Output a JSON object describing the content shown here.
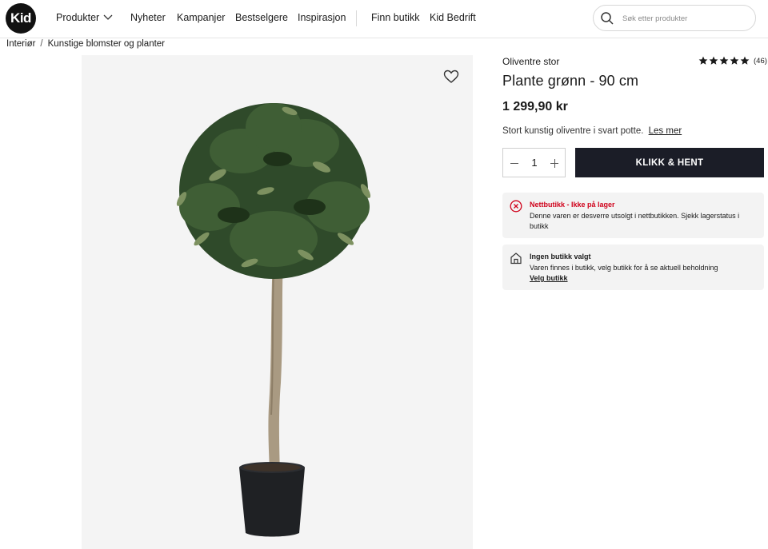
{
  "header": {
    "logo_text": "Kid",
    "nav": [
      {
        "label": "Produkter"
      },
      {
        "label": "Nyheter"
      },
      {
        "label": "Kampanjer"
      },
      {
        "label": "Bestselgere"
      },
      {
        "label": "Inspirasjon"
      },
      {
        "label": "Finn butikk"
      },
      {
        "label": "Kid Bedrift"
      }
    ],
    "search": {
      "placeholder": "Søk etter produkter",
      "value": ""
    }
  },
  "breadcrumb": {
    "items": [
      "Interiør",
      "Kunstige blomster og planter"
    ],
    "separator": "/"
  },
  "product": {
    "brand": "Oliventre stor",
    "title": "Plante grønn - 90 cm",
    "price": "1 299,90 kr",
    "description": "Stort kunstig oliventre i svart potte.",
    "read_more": "Les mer",
    "rating": {
      "stars": 5,
      "count_text": "(46)"
    },
    "quantity": "1",
    "cta_label": "KLIKK & HENT",
    "favorite_icon": "heart-icon"
  },
  "notices": {
    "online": {
      "title": "Nettbutikk - Ikke på lager",
      "body": "Denne varen er desverre utsolgt i nettbutikken. Sjekk lagerstatus i butikk",
      "icon": "x-circle-icon",
      "color": "#d0021b"
    },
    "store": {
      "title": "Ingen butikk valgt",
      "body": "Varen finnes i butikk, velg butikk for å se aktuell beholdning",
      "link": "Velg butikk",
      "icon": "store-icon"
    }
  },
  "colors": {
    "cta_bg": "#1b1d27",
    "accent_red": "#d0021b",
    "panel_bg": "#f3f3f3"
  }
}
